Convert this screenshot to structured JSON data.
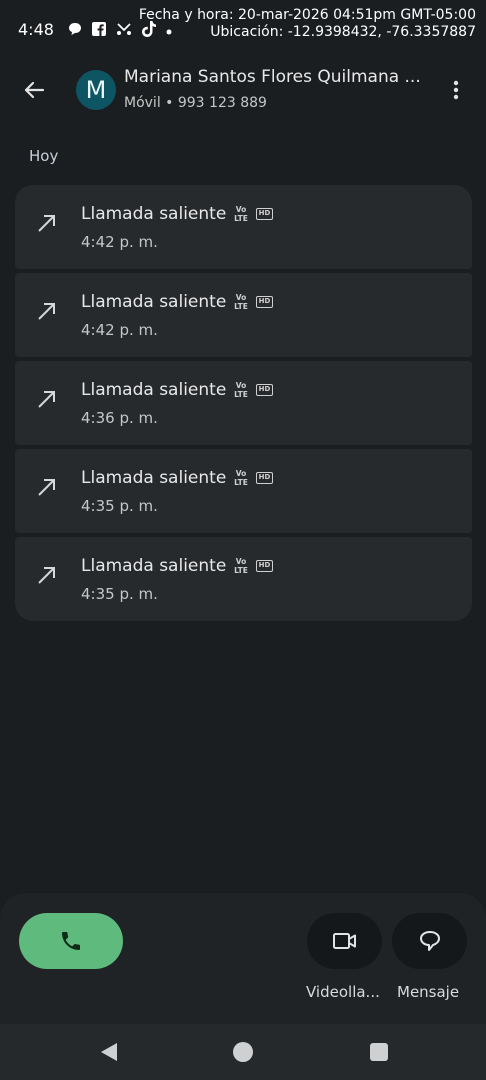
{
  "status_bar": {
    "time": "4:48",
    "overlay_datetime": "Fecha y hora: 20-mar-2026 04:51pm GMT-05:00",
    "overlay_location": "Ubicación: -12.9398432, -76.3357887",
    "icons": [
      "chat-bubble-icon",
      "facebook-icon",
      "missed-call-icon",
      "tiktok-icon",
      "dot-icon",
      "signal-icon",
      "battery-icon"
    ]
  },
  "header": {
    "avatar_letter": "M",
    "contact_name": "Mariana Santos Flores Quilmana ...",
    "contact_sub": "Móvil • 993 123 889"
  },
  "section": {
    "label": "Hoy"
  },
  "calls": [
    {
      "title": "Llamada saliente",
      "time": "4:42 p. m."
    },
    {
      "title": "Llamada saliente",
      "time": "4:42 p. m."
    },
    {
      "title": "Llamada saliente",
      "time": "4:36 p. m."
    },
    {
      "title": "Llamada saliente",
      "time": "4:35 p. m."
    },
    {
      "title": "Llamada saliente",
      "time": "4:35 p. m."
    }
  ],
  "badges": {
    "volte_top": "Vo",
    "volte_bottom": "LTE",
    "hd": "HD"
  },
  "actions": {
    "video_label": "Videolla...",
    "message_label": "Mensaje"
  },
  "colors": {
    "background": "#1b1e21",
    "card": "#272a2d",
    "avatar": "#0e5563",
    "call_button": "#5fba7d"
  }
}
